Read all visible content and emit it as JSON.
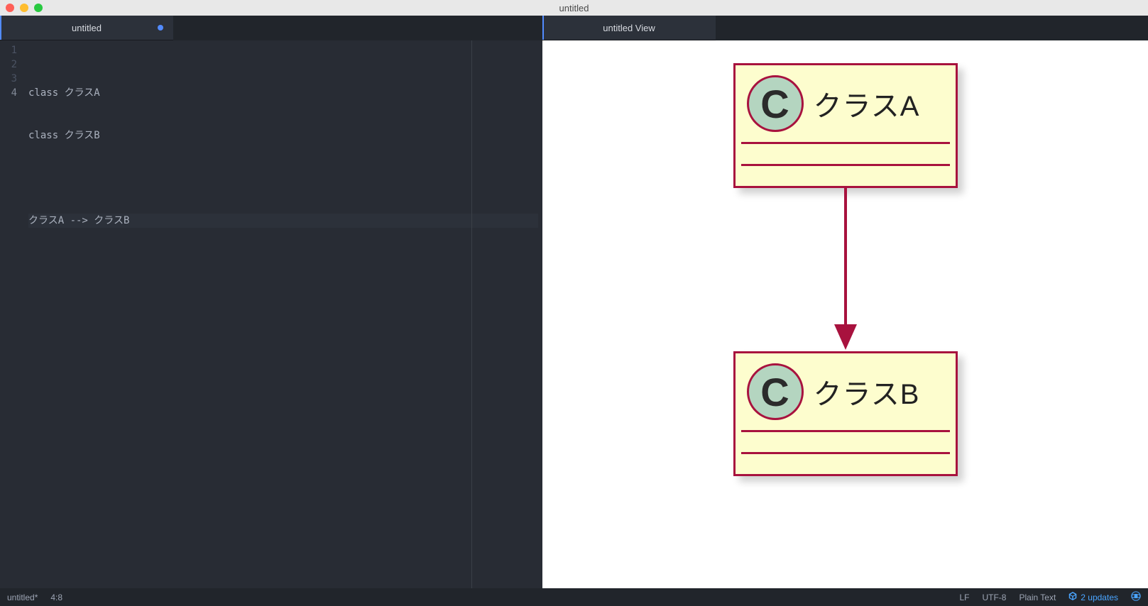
{
  "window": {
    "title": "untitled"
  },
  "tabs": {
    "left": {
      "label": "untitled",
      "dirty": true
    },
    "right": {
      "label": "untitled View"
    }
  },
  "editor": {
    "lines": [
      "class クラスA",
      "class クラスB",
      "",
      "クラスA --> クラスB"
    ],
    "line_numbers": [
      "1",
      "2",
      "3",
      "4"
    ],
    "current_line_index": 3,
    "cursor_after_char": 8
  },
  "diagram": {
    "classA": {
      "badge": "C",
      "name": "クラスA"
    },
    "classB": {
      "badge": "C",
      "name": "クラスB"
    }
  },
  "status": {
    "file": "untitled*",
    "pos": "4:8",
    "eol": "LF",
    "encoding": "UTF-8",
    "grammar": "Plain Text",
    "updates": "2 updates"
  },
  "colors": {
    "uml_border": "#a8123e",
    "uml_fill": "#fdfdce",
    "badge_fill": "#b4d5c0"
  }
}
